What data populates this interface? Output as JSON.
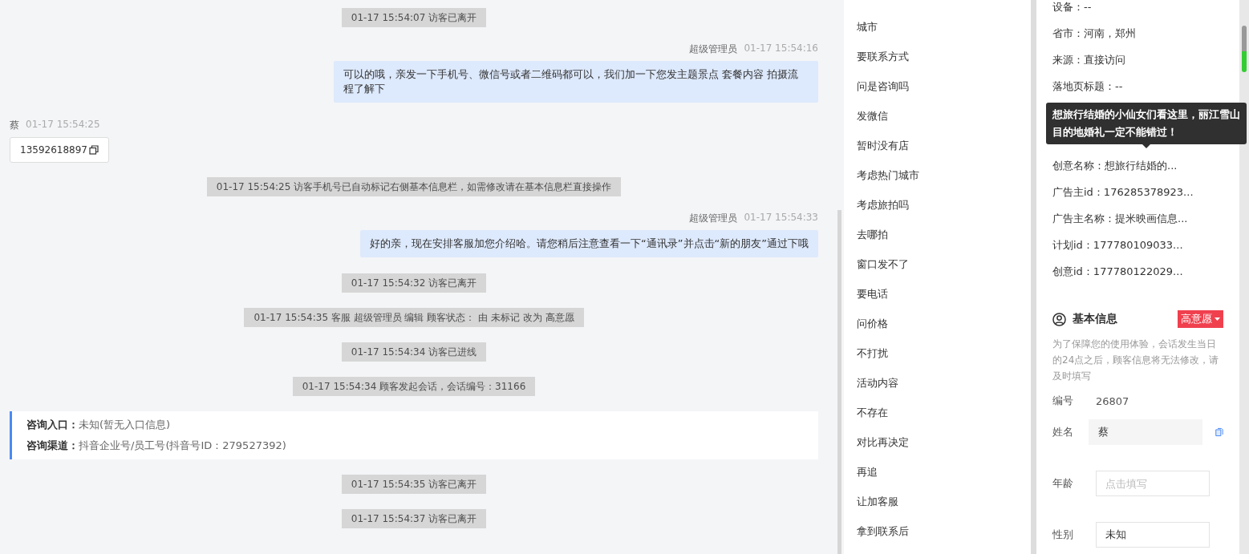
{
  "chat": {
    "messages": [
      {
        "kind": "system",
        "text": "01-17 15:54:07 访客已离开"
      },
      {
        "kind": "agent",
        "sender": "超级管理员",
        "time": "01-17 15:54:16",
        "text": "可以的哦，亲发一下手机号、微信号或者二维码都可以，我们加一下您发主题景点 套餐内容 拍摄流程了解下"
      },
      {
        "kind": "visitor",
        "sender": "蔡",
        "time": "01-17 15:54:25",
        "text": "13592618897"
      },
      {
        "kind": "system",
        "text": "01-17 15:54:25 访客手机号已自动标记右侧基本信息栏，如需修改请在基本信息栏直接操作"
      },
      {
        "kind": "agent",
        "sender": "超级管理员",
        "time": "01-17 15:54:33",
        "text": "好的亲，现在安排客服加您介绍哈。请您稍后注意查看一下“通讯录”并点击“新的朋友”通过下哦"
      },
      {
        "kind": "system",
        "text": "01-17 15:54:32 访客已离开"
      },
      {
        "kind": "system",
        "text": "01-17 15:54:35 客服 超级管理员 编辑 顾客状态： 由 未标记 改为 高意愿"
      },
      {
        "kind": "system",
        "text": "01-17 15:54:34 访客已进线"
      },
      {
        "kind": "system",
        "text": "01-17 15:54:34 顾客发起会话，会话编号：31166"
      },
      {
        "kind": "info",
        "lines": [
          {
            "label": "咨询入口：",
            "value": "未知(暂无入口信息)"
          },
          {
            "label": "咨询渠道：",
            "value": "抖音企业号/员工号(抖音号ID：279527392)"
          }
        ]
      },
      {
        "kind": "system",
        "text": "01-17 15:54:35 访客已离开"
      },
      {
        "kind": "system",
        "text": "01-17 15:54:37 访客已离开"
      }
    ]
  },
  "quick_replies": [
    "城市",
    "要联系方式",
    "问是咨询吗",
    "发微信",
    "暂时没有店",
    "考虑热门城市",
    "考虑旅拍吗",
    "去哪拍",
    "窗口发不了",
    "要电话",
    "问价格",
    "不打扰",
    "活动内容",
    "不存在",
    "对比再决定",
    "再追",
    "让加客服",
    "拿到联系后"
  ],
  "visitor_info": {
    "lines_top": [
      "设备：--",
      "省市：河南，郑州",
      "来源：直接访问",
      "落地页标题：--"
    ],
    "tooltip": "想旅行结婚的小仙女们看这里，丽江雪山目的地婚礼一定不能错过！",
    "lines_bottom": [
      "创意名称：想旅行结婚的...",
      "广告主id：176285378923...",
      "广告主名称：提米映画信息...",
      "计划id：177780109033...",
      "创意id：177780122029..."
    ]
  },
  "basic_info": {
    "title": "基本信息",
    "status": "高意愿",
    "notice": "为了保障您的使用体验，会话发生当日的24点之后，顾客信息将无法修改，请及时填写",
    "id_label": "编号",
    "id_value": "26807",
    "fields": [
      {
        "label": "姓名",
        "value": "蔡",
        "kind": "readonly"
      },
      {
        "label": "年龄",
        "placeholder": "点击填写",
        "kind": "input"
      },
      {
        "label": "性别",
        "value": "未知",
        "kind": "select"
      }
    ]
  }
}
